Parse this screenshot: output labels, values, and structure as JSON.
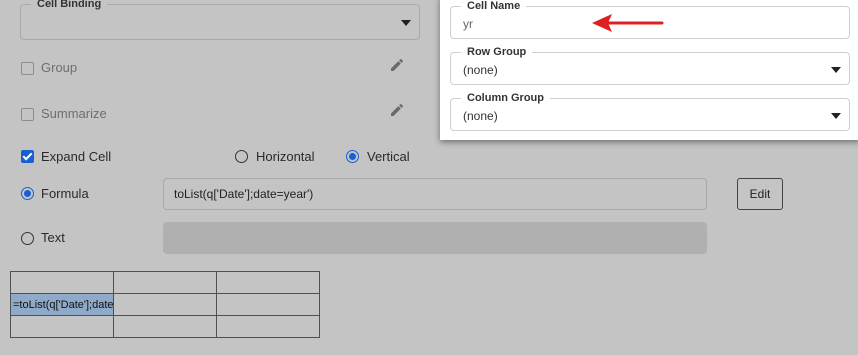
{
  "cell_binding": {
    "label": "Cell Binding",
    "value": ""
  },
  "group": {
    "label": "Group",
    "checked": false
  },
  "summarize": {
    "label": "Summarize",
    "checked": false
  },
  "expand_cell": {
    "label": "Expand Cell",
    "checked": true
  },
  "orientation": {
    "horizontal_label": "Horizontal",
    "vertical_label": "Vertical",
    "selected": "Vertical"
  },
  "formula": {
    "label": "Formula",
    "value": "toList(q['Date'];date=year')",
    "selected": true
  },
  "text": {
    "label": "Text",
    "value": ""
  },
  "edit_button": {
    "label": "Edit"
  },
  "grid": {
    "rows": [
      [
        "",
        "",
        ""
      ],
      [
        "=toList(q['Date'];date=year')",
        "",
        ""
      ],
      [
        "",
        "",
        ""
      ]
    ]
  },
  "popup": {
    "cell_name": {
      "label": "Cell Name",
      "value": "yr"
    },
    "row_group": {
      "label": "Row Group",
      "value": "(none)"
    },
    "column_group": {
      "label": "Column Group",
      "value": "(none)"
    }
  },
  "colors": {
    "accent": "#1a5fd0",
    "arrow": "#e02020",
    "selected_cell": "#8fa9c9"
  },
  "icons": [
    "pencil-icon",
    "caret-down-icon",
    "red-arrow-icon"
  ]
}
